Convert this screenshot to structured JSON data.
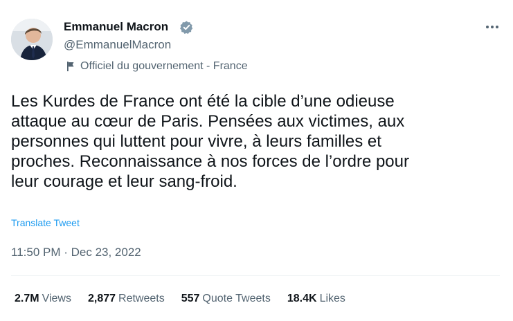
{
  "author": {
    "name": "Emmanuel Macron",
    "handle": "@EmmanuelMacron",
    "verified": true,
    "label": "Officiel du gouvernement - France"
  },
  "tweet": {
    "text": "Les Kurdes de France ont été la cible d’une odieuse\nattaque au cœur de Paris. Pensées aux victimes, aux\npersonnes qui luttent pour vivre, à leurs familles et\nproches. Reconnaissance à nos forces de l’ordre pour\nleur courage et leur sang-froid.",
    "translate_label": "Translate Tweet",
    "timestamp": "11:50 PM · Dec 23, 2022"
  },
  "stats": {
    "views": {
      "count": "2.7M",
      "label": "Views"
    },
    "retweets": {
      "count": "2,877",
      "label": "Retweets"
    },
    "quote_tweets": {
      "count": "557",
      "label": "Quote Tweets"
    },
    "likes": {
      "count": "18.4K",
      "label": "Likes"
    }
  },
  "colors": {
    "text": "#0f1419",
    "secondary": "#536471",
    "link": "#1d9bf0",
    "verified": "#829aab"
  },
  "icons": {
    "verified": "verified-badge-icon",
    "more": "more-options-icon",
    "government_label": "flag-icon"
  }
}
